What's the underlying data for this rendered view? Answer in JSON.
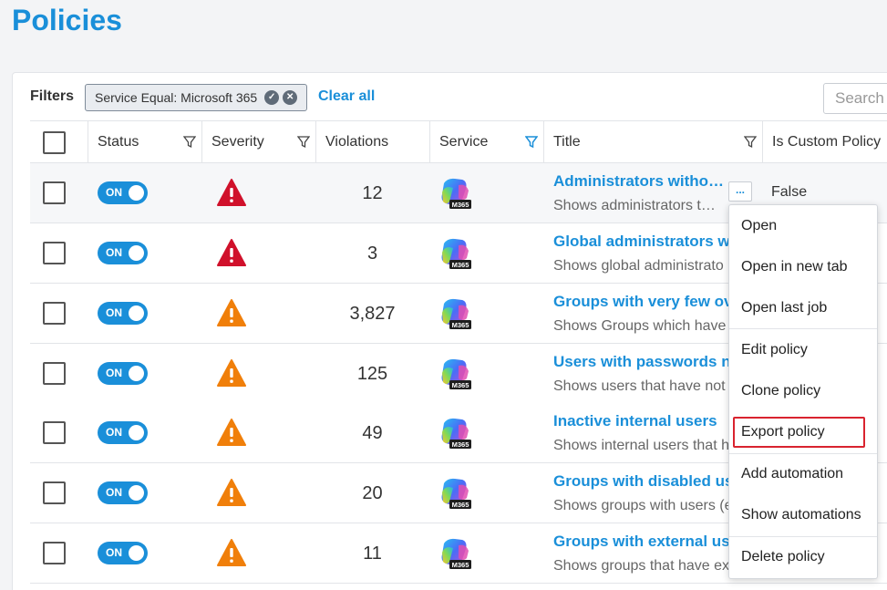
{
  "page": {
    "title": "Policies"
  },
  "filters": {
    "label": "Filters",
    "chip_text": "Service Equal: Microsoft 365",
    "clear_label": "Clear all",
    "search_placeholder": "Search"
  },
  "table": {
    "columns": [
      "Status",
      "Severity",
      "Violations",
      "Service",
      "Title",
      "Is Custom Policy"
    ],
    "rows": [
      {
        "status": "ON",
        "severity": "high",
        "violations": "12",
        "service": "M365",
        "title": "Administrators witho…",
        "desc": "Shows administrators t…",
        "custom": "False"
      },
      {
        "status": "ON",
        "severity": "high",
        "violations": "3",
        "service": "M365",
        "title": "Global administrators w",
        "desc": "Shows global administrato",
        "custom": ""
      },
      {
        "status": "ON",
        "severity": "medium",
        "violations": "3,827",
        "service": "M365",
        "title": "Groups with very few ov",
        "desc": "Shows Groups which have",
        "custom": ""
      },
      {
        "status": "ON",
        "severity": "medium",
        "violations": "125",
        "service": "M365",
        "title": "Users with passwords n",
        "desc": "Shows users that have not",
        "custom": ""
      },
      {
        "status": "ON",
        "severity": "medium",
        "violations": "49",
        "service": "M365",
        "title": "Inactive internal users",
        "desc": "Shows internal users that h",
        "custom": ""
      },
      {
        "status": "ON",
        "severity": "medium",
        "violations": "20",
        "service": "M365",
        "title": "Groups with disabled us",
        "desc": "Shows groups with users (e",
        "custom": ""
      },
      {
        "status": "ON",
        "severity": "medium",
        "violations": "11",
        "service": "M365",
        "title": "Groups with external us",
        "desc": "Shows groups that have ex",
        "custom": ""
      }
    ]
  },
  "more_button": {
    "label": "..."
  },
  "context_menu": {
    "items": [
      "Open",
      "Open in new tab",
      "Open last job",
      "Edit policy",
      "Clone policy",
      "Export policy",
      "Add automation",
      "Show automations",
      "Delete policy"
    ],
    "highlighted": "Export policy"
  },
  "colors": {
    "accent": "#1a8fd9",
    "severity_high": "#d0112b",
    "severity_medium": "#f07f0a",
    "highlight_box": "#d9232f"
  }
}
